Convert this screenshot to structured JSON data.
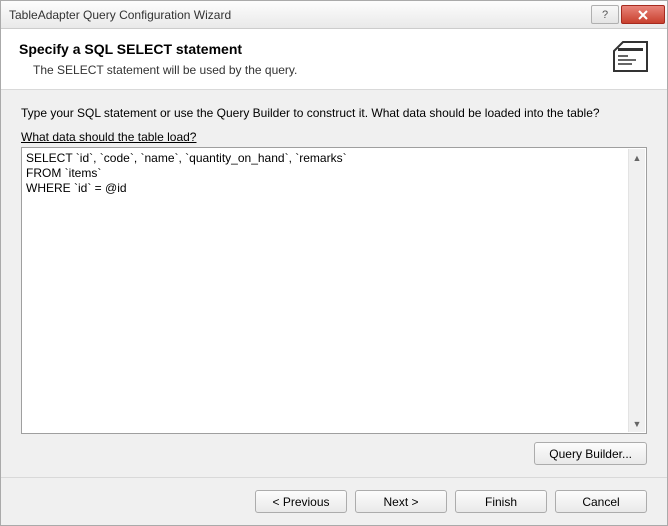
{
  "window": {
    "title": "TableAdapter Query Configuration Wizard"
  },
  "header": {
    "title": "Specify a SQL SELECT statement",
    "subtitle": "The SELECT statement will be used by the query."
  },
  "body": {
    "instruction": "Type your SQL statement or use the Query Builder to construct it. What data should be loaded into the table?",
    "field_label": "What data should the table load?",
    "sql_line1": "SELECT `id`, `code`, `name`, `quantity_on_hand`, `remarks`",
    "sql_line2": "FROM `items`",
    "sql_line3_selected": "WHERE `id` = @id",
    "query_builder_btn": "Query Builder..."
  },
  "footer": {
    "previous": "< Previous",
    "next": "Next >",
    "finish": "Finish",
    "cancel": "Cancel"
  }
}
